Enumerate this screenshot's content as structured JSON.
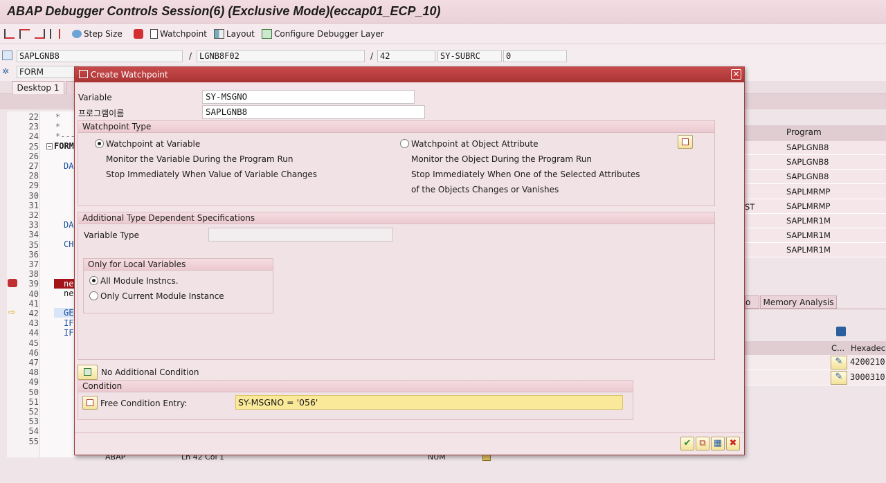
{
  "window": {
    "title": "ABAP Debugger Controls Session(6)  (Exclusive Mode)(eccap01_ECP_10)"
  },
  "toolbar": {
    "step_size": "Step Size",
    "watchpoint": "Watchpoint",
    "layout": "Layout",
    "configure": "Configure Debugger Layer"
  },
  "header_fields": {
    "program": "SAPLGNB8",
    "sep1": "/",
    "include": "LGNB8F02",
    "sep2": "/",
    "line": "42",
    "sysvar": "SY-SUBRC",
    "sysval": "0",
    "event_type": "FORM"
  },
  "tabs": {
    "desktop1": "Desktop 1",
    "memory_analysis": "Memory Analysis",
    "partial": "o"
  },
  "source": {
    "lines": [
      "22",
      "23",
      "24",
      "25",
      "26",
      "27",
      "28",
      "29",
      "30",
      "31",
      "32",
      "33",
      "34",
      "35",
      "36",
      "37",
      "38",
      "39",
      "40",
      "41",
      "42",
      "43",
      "44",
      "45",
      "46",
      "47",
      "48",
      "49",
      "50",
      "51",
      "52",
      "53",
      "54",
      "55"
    ],
    "code": {
      "l22": "*",
      "l23": "*",
      "l24": "*----",
      "l25": "FORM",
      "l27": "DA",
      "l33": "DA",
      "l35": "CH",
      "l39": "ne",
      "l40": "ne",
      "l42": "GE",
      "l43": "IF",
      "l44": "IF"
    },
    "status": {
      "abap": "ABAP",
      "pos": "Ln 42 Col  1",
      "mode": "NUM"
    }
  },
  "stack_table": {
    "header": "Program",
    "partial": "ST",
    "rows": [
      "SAPLGNB8",
      "SAPLGNB8",
      "SAPLGNB8",
      "SAPLMRMP",
      "SAPLMRMP",
      "SAPLMR1M",
      "SAPLMR1M",
      "SAPLMR1M"
    ]
  },
  "var_table": {
    "col_c": "C...",
    "col_hex": "Hexadecim",
    "rows": [
      "4200210",
      "3000310"
    ]
  },
  "dialog": {
    "title": "Create Watchpoint",
    "variable_label": "Variable",
    "variable_value": "SY-MSGNO",
    "program_label": "프로그램이름",
    "program_value": "SAPLGNB8",
    "wp_type": {
      "header": "Watchpoint Type",
      "opt_variable": "Watchpoint at Variable",
      "var_desc1": "Monitor the Variable During the Program Run",
      "var_desc2": "Stop Immediately When Value of Variable Changes",
      "opt_object": "Watchpoint at Object Attribute",
      "obj_desc1": "Monitor the Object During the Program Run",
      "obj_desc2": "Stop Immediately When One of the Selected Attributes",
      "obj_desc3": "of the Objects Changes or Vanishes"
    },
    "additional": {
      "header": "Additional Type Dependent Specifications",
      "var_type_label": "Variable Type",
      "var_type_value": "",
      "local_header": "Only for Local Variables",
      "opt_all": "All Module Instncs.",
      "opt_current": "Only Current Module Instance"
    },
    "no_condition": "No Additional Condition",
    "condition": {
      "header": "Condition",
      "label": "Free Condition Entry:",
      "value": "SY-MSGNO = '056'"
    }
  }
}
